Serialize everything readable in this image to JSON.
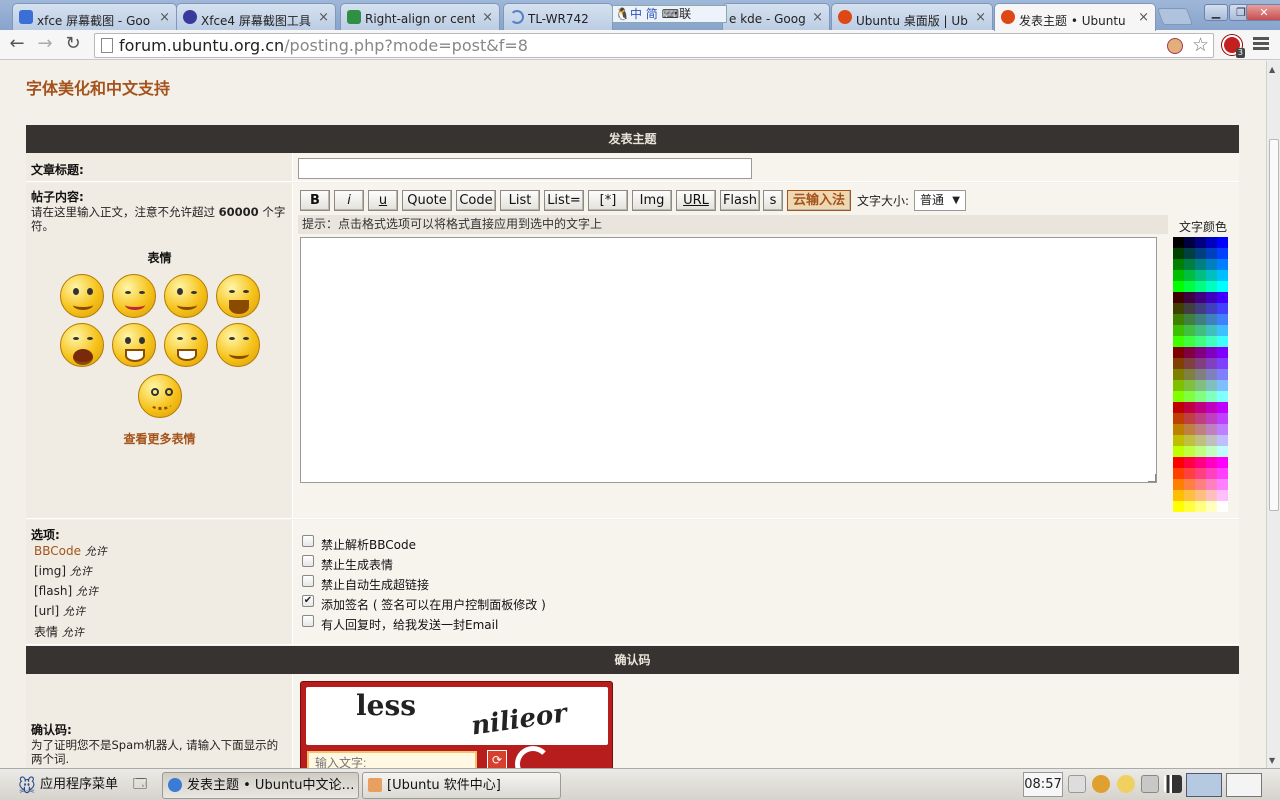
{
  "browser": {
    "tabs": [
      {
        "label": "xfce 屏幕截图 - Goo",
        "fav_color": "#3b6fd6",
        "fav_icon": "google-icon"
      },
      {
        "label": "Xfce4 屏幕截图工具",
        "fav_color": "#3a3a9e",
        "fav_icon": "xfce-icon"
      },
      {
        "label": "Right-align or cent",
        "fav_color": "#2f8f44",
        "fav_icon": "site-icon"
      },
      {
        "label": "TL-WR742N",
        "fav_color": "#5b7fc7",
        "fav_icon": "loading-icon"
      },
      {
        "label": "e kde - Goog",
        "fav_color": "#3b6fd6",
        "fav_icon": "google-icon"
      },
      {
        "label": "Ubuntu 桌面版 | Ub",
        "fav_color": "#dd4814",
        "fav_icon": "ubuntu-icon"
      },
      {
        "label": "发表主题 • Ubuntu",
        "fav_color": "#dd4814",
        "fav_icon": "ubuntu-icon"
      }
    ],
    "ime_text": "中 简",
    "ime_lian": "联",
    "url_domain": "forum.ubuntu.org.cn",
    "url_path": "/posting.php?mode=post&f=8",
    "adblock_count": "3"
  },
  "page": {
    "forum_title": "字体美化和中文支持",
    "post_bar": "发表主题",
    "subject_label": "文章标题:",
    "subject_value": "",
    "body_label": "帖子内容:",
    "body_hint_1": "请在这里输入正文，注意不允许超过",
    "body_limit": "60000",
    "body_hint_2": "个字符。",
    "emoticons_label": "表情",
    "more_emoticons": "查看更多表情",
    "buttons": [
      "B",
      "i",
      "u",
      "Quote",
      "Code",
      "List",
      "List=",
      "[*]",
      "Img",
      "URL",
      "Flash",
      "s"
    ],
    "cloud_ime": "云输入法",
    "font_size_label": "文字大小:",
    "font_size_value": "普通",
    "format_hint": "提示：点击格式选项可以将格式直接应用到选中的文字上",
    "font_color_label": "文字颜色",
    "editor_value": "",
    "options_label": "选项:",
    "options_left": [
      {
        "name": "BBCode",
        "state": "允许"
      },
      {
        "name": "[img]",
        "state": "允许"
      },
      {
        "name": "[flash]",
        "state": "允许"
      },
      {
        "name": "[url]",
        "state": "允许"
      },
      {
        "name": "表情",
        "state": "允许"
      }
    ],
    "checkboxes": [
      {
        "label": "禁止解析BBCode",
        "checked": false
      },
      {
        "label": "禁止生成表情",
        "checked": false
      },
      {
        "label": "禁止自动生成超链接",
        "checked": false
      },
      {
        "label": "添加签名 ( 签名可以在用户控制面板修改 )",
        "checked": true
      },
      {
        "label": "有人回复时，给我发送一封Email",
        "checked": false
      }
    ],
    "captcha_bar": "确认码",
    "captcha_label": "确认码:",
    "captcha_desc": "为了证明您不是Spam机器人, 请输入下面显示的两个词.",
    "captcha_word1": "less",
    "captcha_word2": "nilieor",
    "captcha_input_placeholder": "输入文字:"
  },
  "taskbar": {
    "app_menu": "应用程序菜单",
    "tasks": [
      {
        "label": "发表主题 • Ubuntu中文论…",
        "active": true
      },
      {
        "label": "[Ubuntu 软件中心]",
        "active": false
      }
    ],
    "clock": "08:57"
  },
  "colors": {
    "accent": "#a3531b",
    "bar": "#373330",
    "captcha": "#b81d1d"
  }
}
